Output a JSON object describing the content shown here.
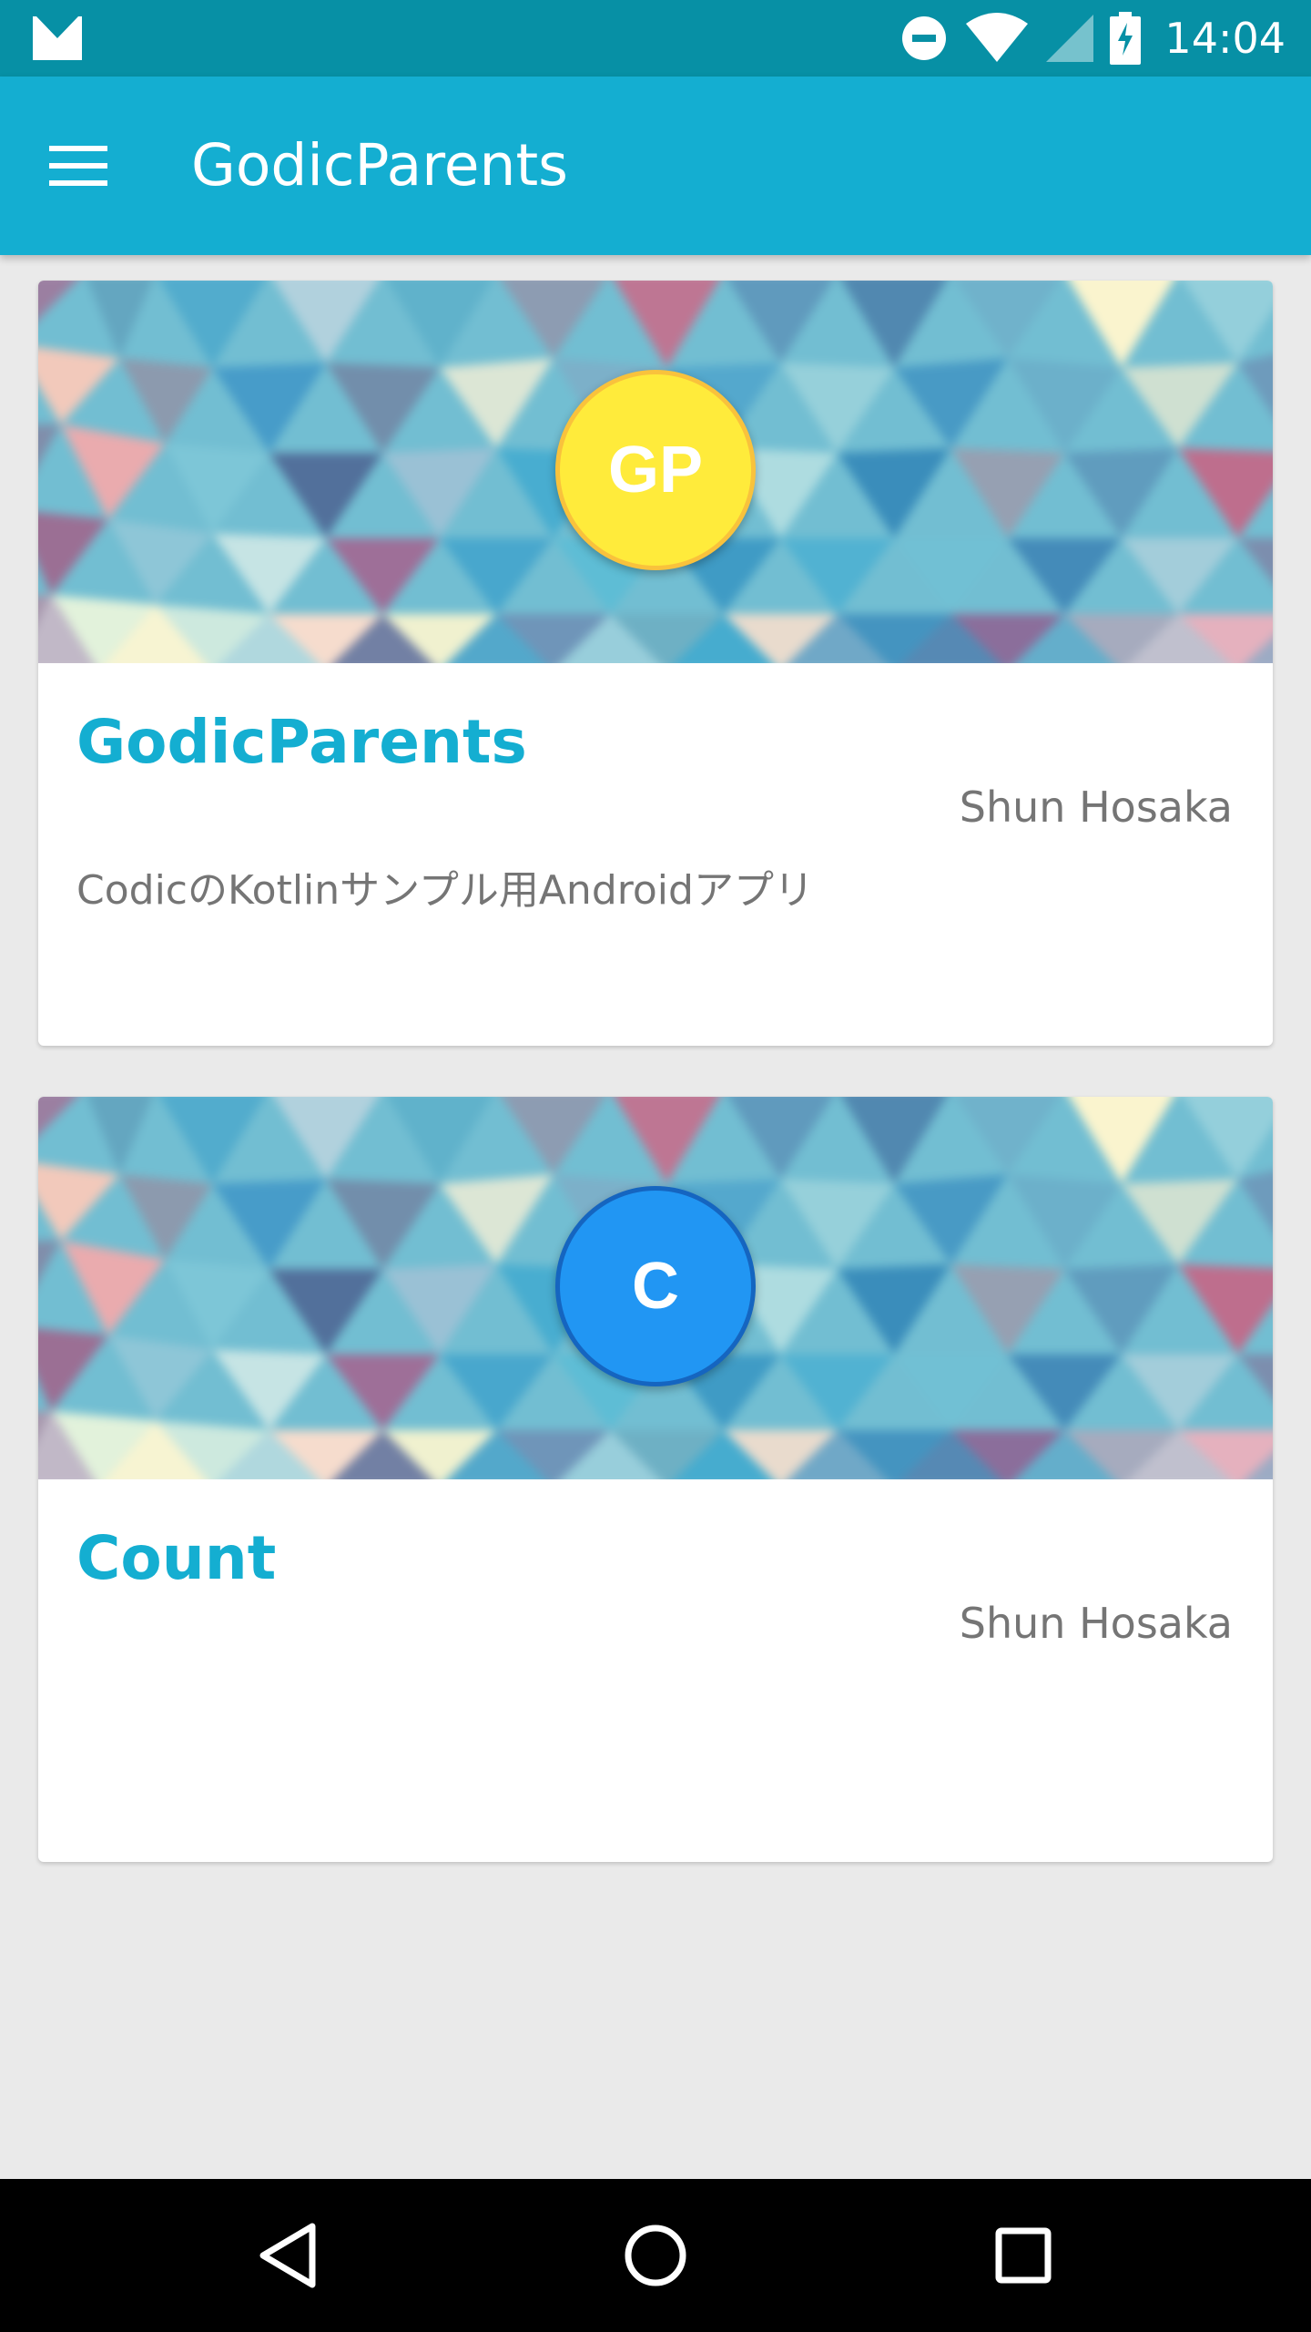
{
  "status_bar": {
    "time": "14:04",
    "icons": [
      "gmail-icon",
      "do-not-disturb-icon",
      "wifi-icon",
      "cell-signal-icon",
      "battery-charging-icon"
    ]
  },
  "app_bar": {
    "title": "GodicParents",
    "menu_icon": "hamburger-menu-icon"
  },
  "colors": {
    "status_bar": "#0790A5",
    "app_bar": "#14AED1",
    "title_accent": "#14AED1",
    "background": "#EAEAEA",
    "avatar_yellow": "#FFEB3B",
    "avatar_blue": "#2196F3"
  },
  "cards": [
    {
      "avatar_text": "GP",
      "avatar_color": "#FFEB3B",
      "title": "GodicParents",
      "author": "Shun Hosaka",
      "description": "CodicのKotlinサンプル用Androidアプリ"
    },
    {
      "avatar_text": "C",
      "avatar_color": "#2196F3",
      "title": "Count",
      "author": "Shun Hosaka",
      "description": ""
    }
  ],
  "nav_bar": {
    "icons": [
      "back-icon",
      "home-icon",
      "recent-apps-icon"
    ]
  }
}
